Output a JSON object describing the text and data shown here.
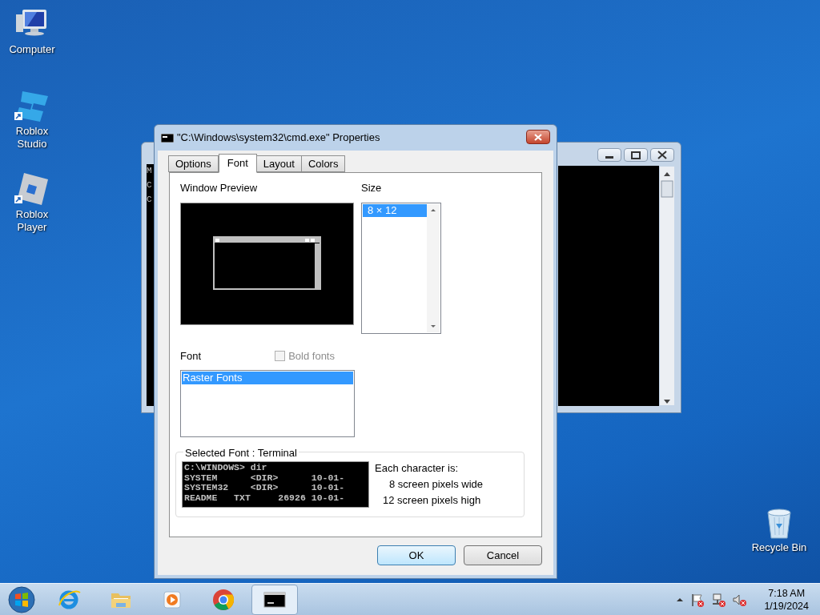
{
  "desktop_icons": [
    {
      "label": "Computer",
      "kind": "computer"
    },
    {
      "label": "Roblox Studio",
      "kind": "studio"
    },
    {
      "label": "Roblox Player",
      "kind": "player"
    },
    {
      "label": "Recycle Bin",
      "kind": "bin"
    }
  ],
  "console_window": {
    "lines": [
      "M",
      "C",
      "C"
    ]
  },
  "dialog": {
    "title": "\"C:\\Windows\\system32\\cmd.exe\" Properties",
    "tabs": [
      {
        "label": "Options",
        "selected": false
      },
      {
        "label": "Font",
        "selected": true
      },
      {
        "label": "Layout",
        "selected": false
      },
      {
        "label": "Colors",
        "selected": false
      }
    ],
    "window_preview_label": "Window Preview",
    "size_label": "Size",
    "sizes": [
      {
        "label": "8 × 12",
        "selected": true
      }
    ],
    "font_label": "Font",
    "bold_fonts": {
      "label": "Bold fonts",
      "checked": false,
      "disabled": true
    },
    "fonts": [
      {
        "label": "Raster Fonts",
        "selected": true
      }
    ],
    "selected_font": {
      "title": "Selected Font : Terminal",
      "sample_lines": [
        "C:\\WINDOWS> dir",
        "SYSTEM      <DIR>      10-01-",
        "SYSTEM32    <DIR>      10-01-",
        "README   TXT     26926 10-01-"
      ],
      "info": [
        "Each character is:",
        "8 screen pixels wide",
        "12 screen pixels high"
      ]
    },
    "buttons": [
      {
        "label": "OK",
        "default": true
      },
      {
        "label": "Cancel",
        "default": false
      }
    ]
  },
  "taskbar": {
    "apps": [
      {
        "kind": "ie",
        "active": false
      },
      {
        "kind": "folder",
        "active": false
      },
      {
        "kind": "media",
        "active": false
      },
      {
        "kind": "chrome",
        "active": false
      },
      {
        "kind": "cmd",
        "active": true
      }
    ],
    "clock": {
      "time": "7:18 AM",
      "date": "1/19/2024"
    }
  }
}
